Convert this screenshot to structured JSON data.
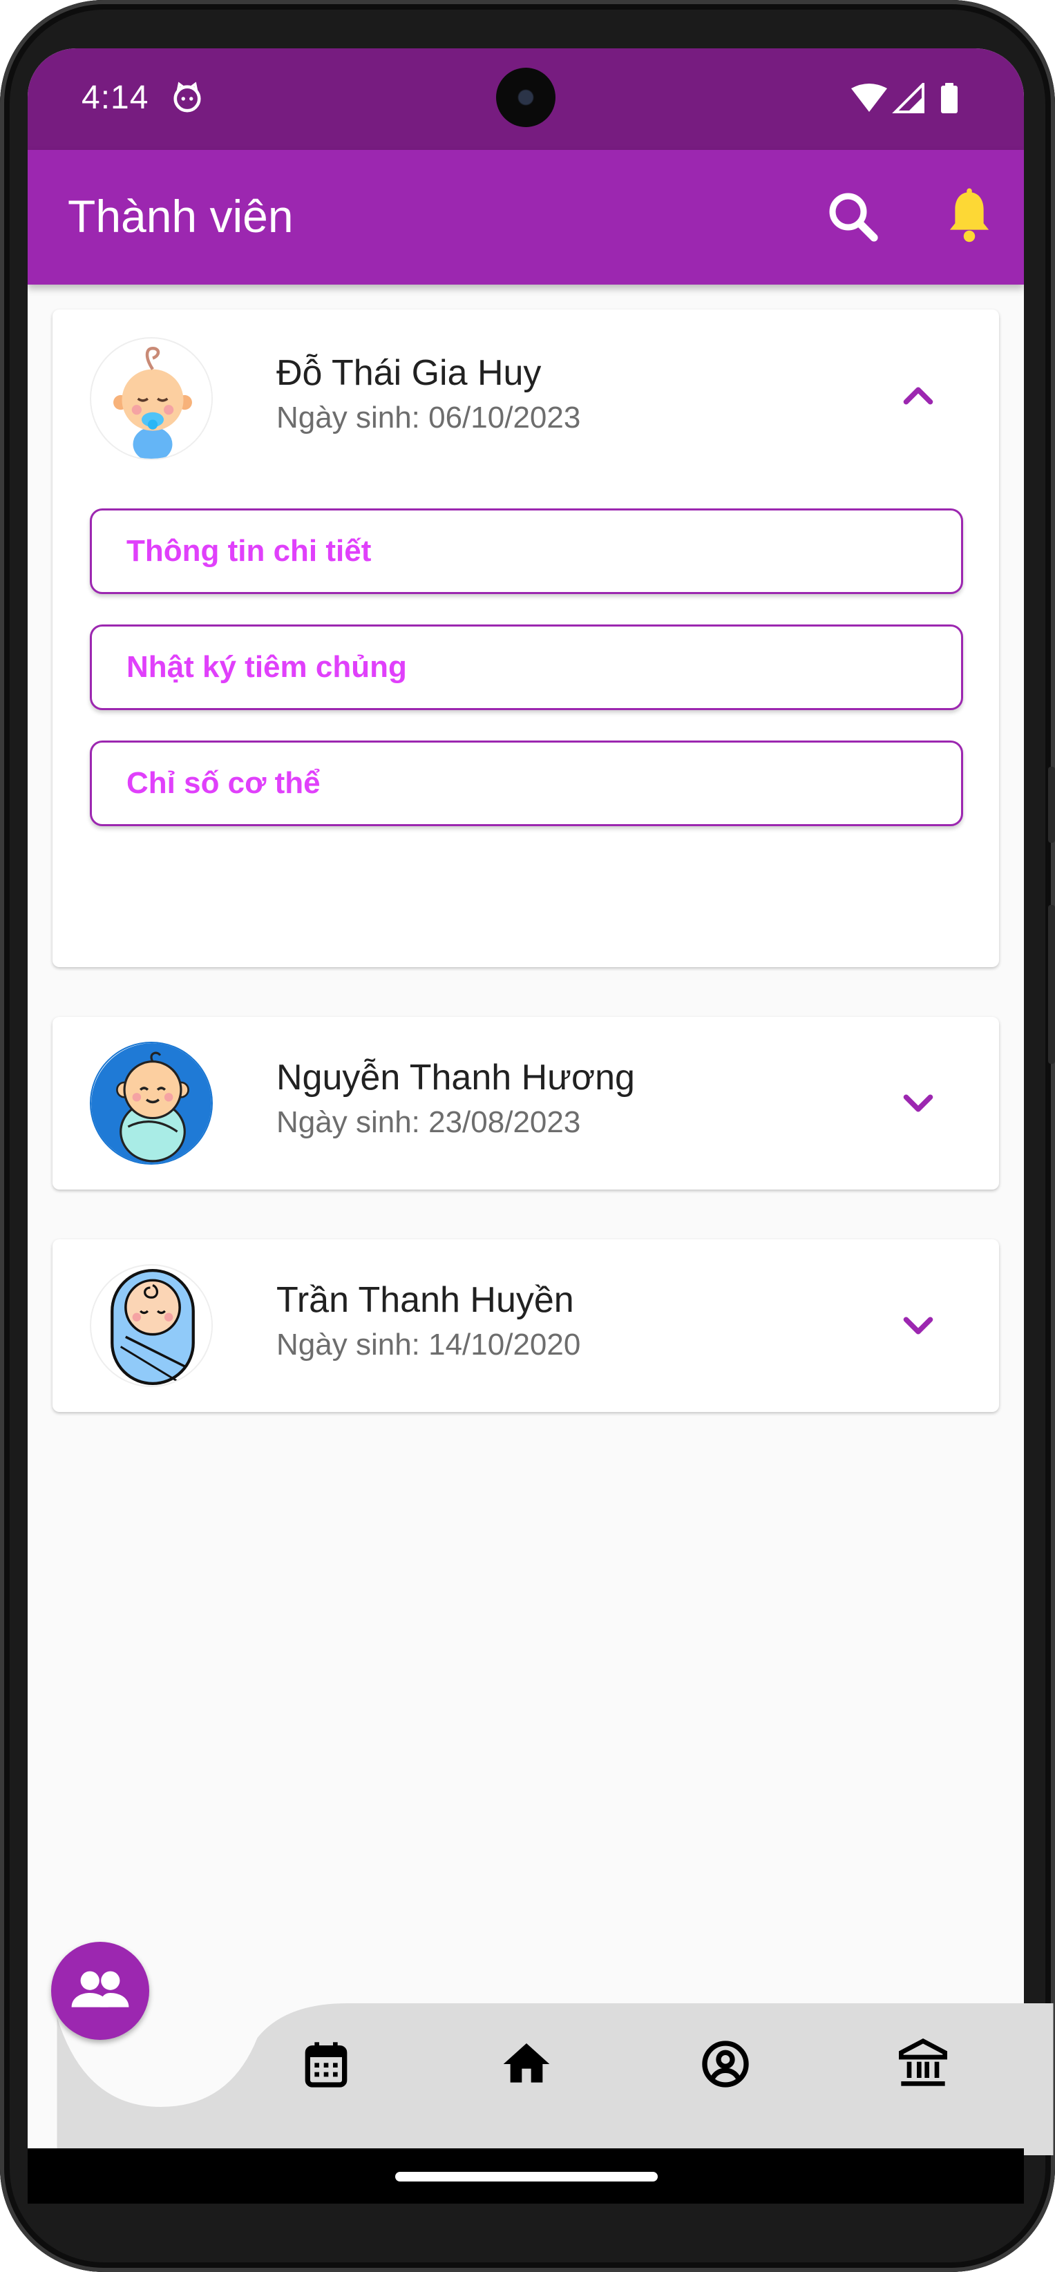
{
  "status_bar": {
    "time": "4:14",
    "icons": [
      "cat-notification-icon",
      "wifi-icon",
      "signal-icon",
      "battery-icon"
    ]
  },
  "app_bar": {
    "title": "Thành viên",
    "actions": [
      "search-icon",
      "bell-icon"
    ],
    "colors": {
      "background": "#9c27b0",
      "status": "#771c80",
      "bell": "#fdd835"
    }
  },
  "members": [
    {
      "name": "Đỗ Thái Gia Huy",
      "dob": "Ngày sinh: 06/10/2023",
      "expanded": true,
      "avatar": "baby-pacifier-avatar",
      "actions": [
        {
          "label": "Thông tin chi tiết"
        },
        {
          "label": "Nhật ký tiêm chủng"
        },
        {
          "label": "Chỉ số cơ thể"
        }
      ]
    },
    {
      "name": "Nguyễn Thanh Hương",
      "dob": "Ngày sinh: 23/08/2023",
      "expanded": false,
      "avatar": "baby-blanket-blue-avatar"
    },
    {
      "name": "Trần Thanh Huyền",
      "dob": "Ngày sinh: 14/10/2020",
      "expanded": false,
      "avatar": "baby-swaddled-avatar"
    }
  ],
  "bottom_nav": {
    "active": "members",
    "items": [
      "members-icon",
      "calendar-icon",
      "home-icon",
      "account-icon",
      "bank-icon"
    ],
    "colors": {
      "active": "#9c27b0",
      "bar": "#dcdcdc"
    }
  }
}
